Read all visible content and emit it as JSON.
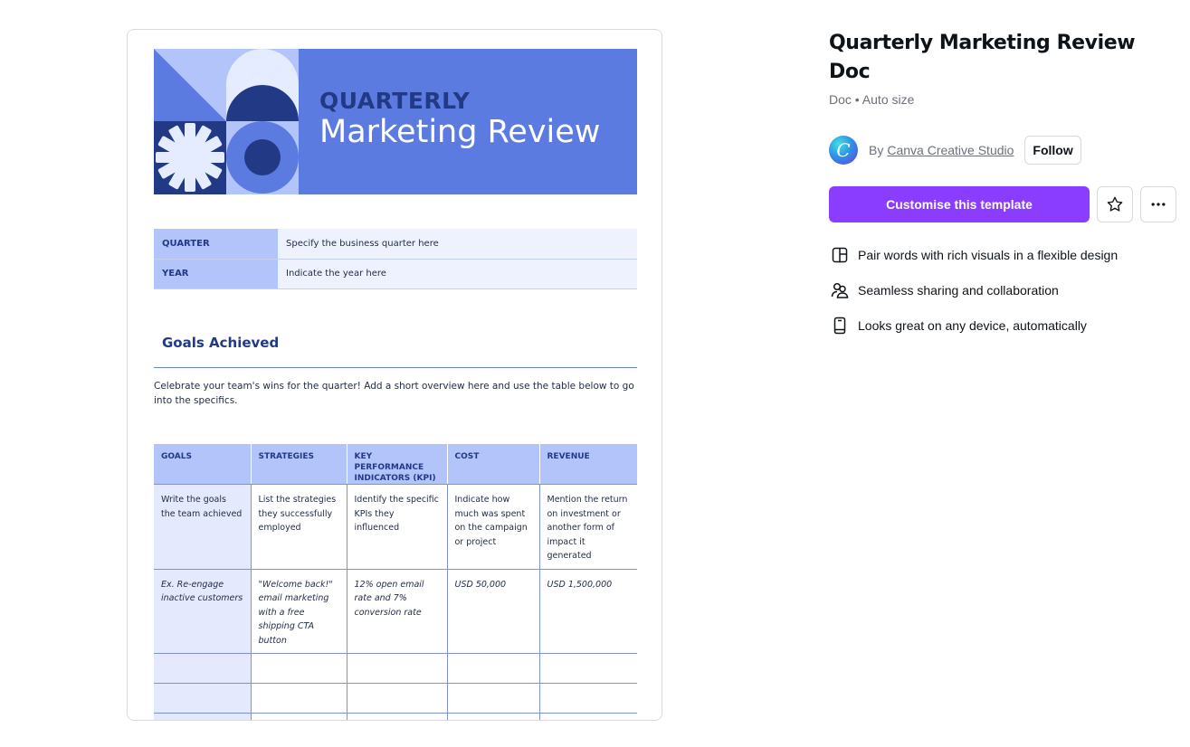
{
  "preview": {
    "banner": {
      "line1": "QUARTERLY",
      "line2": "Marketing Review"
    },
    "info_rows": [
      {
        "key": "QUARTER",
        "value": "Specify the business quarter here"
      },
      {
        "key": "YEAR",
        "value": "Indicate the year here"
      }
    ],
    "section_heading": "Goals Achieved",
    "overview": "Celebrate your team's wins for the quarter! Add a short overview here and use the table below to go into the specifics.",
    "table": {
      "headers": [
        "GOALS",
        "STRATEGIES",
        "KEY PERFORMANCE INDICATORS (KPI)",
        "COST",
        "REVENUE"
      ],
      "rows": [
        [
          "Write the goals the team achieved",
          "List the strategies they successfully employed",
          "Identify the specific KPIs they influenced",
          "Indicate how much was spent on the campaign or project",
          "Mention the return on investment or another form of impact it generated"
        ],
        [
          "Ex. Re-engage inactive customers",
          "\"Welcome back!\" email marketing with a free shipping CTA button",
          "12% open email rate and 7% conversion rate",
          "USD 50,000",
          "USD 1,500,000"
        ]
      ]
    }
  },
  "panel": {
    "title": "Quarterly Marketing Review Doc",
    "meta": "Doc • Auto size",
    "avatar_letter": "C",
    "by_label": "By",
    "author": "Canva Creative Studio",
    "follow_label": "Follow",
    "cta_label": "Customise this template",
    "favorite_icon": "star-icon",
    "more_icon": "more-icon",
    "features": [
      {
        "icon": "layout-icon",
        "label": "Pair words with rich visuals in a flexible design"
      },
      {
        "icon": "people-icon",
        "label": "Seamless sharing and collaboration"
      },
      {
        "icon": "device-icon",
        "label": "Looks great on any device, automatically"
      }
    ]
  },
  "colors": {
    "accent": "#8b3dff",
    "banner": "#5b7be1",
    "banner_dark": "#223a86",
    "table_header": "#b3c4fb"
  }
}
